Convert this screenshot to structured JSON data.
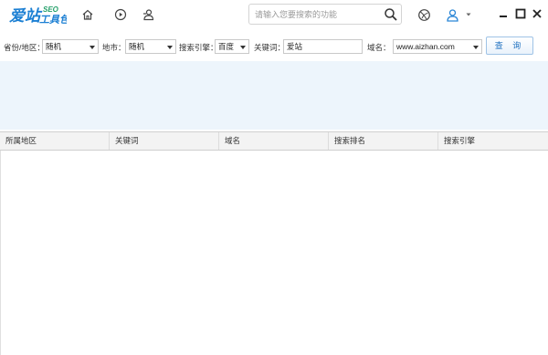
{
  "app": {
    "logo_main": "爱站",
    "logo_sub": "工具包",
    "logo_badge": "SEO"
  },
  "toolbar": {
    "icons": [
      "home-icon",
      "play-circle-icon",
      "user-location-icon"
    ],
    "search_placeholder": "请输入您要搜索的功能",
    "right_icons": [
      "network-icon",
      "user-icon",
      "dropdown-arrow-icon",
      "minimize-icon",
      "maximize-icon",
      "close-icon"
    ]
  },
  "filters": {
    "province_label": "省份/地区：",
    "province_value": "随机",
    "city_label": "地市：",
    "city_value": "随机",
    "engine_label": "搜索引擎：",
    "engine_value": "百度",
    "keyword_label": "关键词：",
    "keyword_value": "爱站",
    "domain_label": "域名：",
    "domain_value": "www.aizhan.com",
    "query_label": "查 询"
  },
  "table": {
    "columns": [
      "所属地区",
      "关键词",
      "域名",
      "搜索排名",
      "搜索引擎"
    ],
    "rows": []
  },
  "colors": {
    "brand_blue": "#1b7fd3",
    "brand_green": "#25a06a",
    "banner_bg": "#edf5fc"
  }
}
